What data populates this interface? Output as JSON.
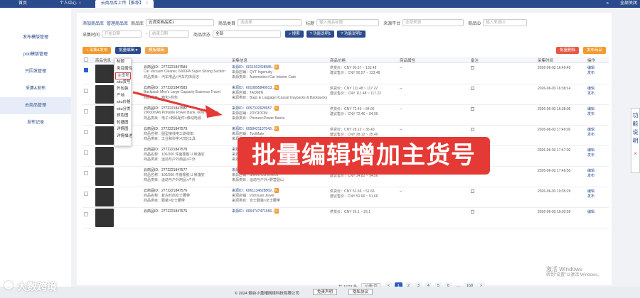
{
  "topbar": {
    "tabs": [
      {
        "label": "首页"
      },
      {
        "label": "个人中心"
      },
      {
        "label": "云商品库上传【推荐】"
      }
    ],
    "close_glyph": "×",
    "arrow_label": "»",
    "right_link": "全部关闭"
  },
  "sidebar": {
    "items": [
      {
        "label": "发布模版管理"
      },
      {
        "label": "pod模版管理"
      },
      {
        "label": "只因发管理"
      },
      {
        "label": "采集&发布"
      },
      {
        "label": "云商品管理"
      },
      {
        "label": "发布记录"
      }
    ]
  },
  "filters": {
    "link_add": "添加商品库",
    "link_manage": "管理商品库",
    "lib_label": "商品库",
    "lib_value": "云货奕商品库1",
    "cat_label": "商品类目",
    "cat_placeholder": "选选择",
    "title_label": "标题",
    "title_placeholder": "输入商品标题",
    "platform_label": "来源平台",
    "platform_placeholder": "全部来源",
    "pid_label": "商品ID",
    "pid_placeholder": "输入来源ID",
    "time_label": "采集时间",
    "start_placeholder": "开始日期",
    "to_label": "-",
    "end_placeholder": "结束日期",
    "status_label": "商品状态",
    "status_value": "全部",
    "search_btn": "搜索",
    "func1_btn": "功能说明1",
    "func2_btn": "功能说明2"
  },
  "actions": {
    "collect_publish": "采集&发布",
    "batch_edit": "批量编辑",
    "template_edit": "模板编辑",
    "batch_delete": "批量删除",
    "publish_goods": "发布商品"
  },
  "dropdown": {
    "items": [
      "标题",
      "类目属性",
      "主货号",
      "sku货号",
      "外包装",
      "产地",
      "sku价格",
      "sku分类",
      "颜色图",
      "轮播图",
      "详情图",
      "详情描述"
    ],
    "highlighted_index": 2
  },
  "table": {
    "headers": [
      "商品信息",
      "采集信息",
      "商品价格",
      "商品属性",
      "备注",
      "采集时间",
      "操作"
    ],
    "rows": [
      {
        "id": "云商品ID：2772221847584",
        "t1": "Car Vacuum Cleaner, 6000PA Super Strong Suction",
        "t2": "商品类目：汽车用品>汽车内饰清洁",
        "src_id": "来源ID：6011032328585...",
        "src_shop": "来源店铺：QYT Ingenuity",
        "src_cat": "来源类目：Automotive>Car Interior Care",
        "price1": "供货价：CNY 90.57 ~ 133.48",
        "price2": "建议售价：CNY 90.57 ~ 133.48",
        "attr": "--",
        "time": "2026-06-03 16:40:40",
        "op1": "编辑",
        "op2": "发布",
        "checked": true
      },
      {
        "id": "云商品ID：2772221847583",
        "t1": "Backpack Men's Large Capacity Business Travel",
        "t2": "商品类目：箱包>背包",
        "src_id": "来源ID：6010895840013...",
        "src_shop": "来源店铺：TAOMIN",
        "src_cat": "来源类目：Bags & Luggage>Casual Daypacks & Backpacks",
        "price1": "供货价：CNY 111.48 ~ 117.22",
        "price2": "建议售价：CNY 111.48 ~ 117.22",
        "attr": "--",
        "time": "2026-06-03 16:38:14",
        "op1": "编辑",
        "op2": "发布",
        "checked": false
      },
      {
        "id": "云商品ID：2772221847582",
        "t1": "20000mAh Portable Power Bank, 66W Portable",
        "t2": "商品类目：电子>数码配件>移动电源",
        "src_id": "来源ID：6057332628957...",
        "src_shop": "来源店铺：JOYROOM",
        "src_cat": "来源类目：Phones>Power Banks",
        "price1": "供货价：CNY 72.46 ~ 84.06",
        "price2": "建议售价：CNY 72.46 ~ 84.06",
        "attr": "--",
        "time": "2026-06-03 16:38:05",
        "op1": "编辑",
        "op2": "发布",
        "checked": false
      },
      {
        "id": "云商品ID：2772221847579",
        "t1": "商品名称：圆型接线电工剥线钳",
        "t2": "商品类目：工业和科学>切割工具",
        "src_id": "来源ID：6058421137543...",
        "src_shop": "来源店铺：ToolMate",
        "src_cat": "来源类目：工具>手动工具",
        "price1": "供货价：CNY 28.12 ~ 35.40",
        "price2": "建议售价：CNY 28.12 ~ 35.40",
        "attr": "--",
        "time": "2026-06-03 17:49:02",
        "op1": "编辑",
        "op2": "发布",
        "checked": false
      },
      {
        "id": "云商品ID：2772221847578",
        "t1": "商品名称：100/200 件装橡胶 U 帐篷钉",
        "t2": "商品类目：运动与户外用品>户外",
        "src_id": "来源ID：6056913972439...",
        "src_shop": "来源店铺：Shenri Commerce",
        "src_cat": "来源类目：运动与户外>野营登山",
        "price1": "供货价：CNY 34.62 ~ 94.56",
        "price2": "建议售价：CNY 34.62 ~ 94.56",
        "attr": "--",
        "time": "2026-06-03 17:47:02",
        "op1": "编辑",
        "op2": "发布",
        "checked": false
      },
      {
        "id": "云商品ID：2772221847577",
        "t1": "商品名称：100/200 件装橡胶 U 帐篷钉",
        "t2": "商品类目：运动与户外用品>户外",
        "src_id": "来源ID：6058913372439...",
        "src_shop": "来源店铺：Shenri Commerce",
        "src_cat": "来源类目：运动与户外>野营登山",
        "price1": "供货价：CNY 34.82 ~ 94.56",
        "price2": "建议售价：CNY 34.82 ~ 94.56",
        "attr": "--",
        "time": "2026-06-03 17:46:50",
        "op1": "编辑",
        "op2": "发布",
        "checked": false
      },
      {
        "id": "云商品ID：2772221847576",
        "t1": "商品名称：复古时尚女士腰带",
        "t2": "商品类目：服装>女士腰带",
        "src_id": "来源ID：6061134628869...",
        "src_shop": "来源店铺：Irishyuan Jewel",
        "src_cat": "来源类目：女士服装>女士腰带",
        "price1": "供货价：CNY 51.66 ~ 51.66",
        "price2": "建议售价：CNY 51.66 ~ 51.66",
        "attr": "--",
        "time": "2026-06-03 10:35:29",
        "op1": "编辑",
        "op2": "发布",
        "checked": false
      },
      {
        "id": "云商品ID：2772221847575",
        "t1": "",
        "t2": "",
        "src_id": "来源ID：6064747471566...",
        "src_shop": "",
        "src_cat": "",
        "price1": "供货价：CNY 26.1 ~ 26.1",
        "price2": "",
        "attr": "",
        "time": "2026-06-03 10:02:59",
        "op1": "编辑",
        "op2": "",
        "checked": false
      }
    ]
  },
  "banner": {
    "text": "批量编辑增加主货号"
  },
  "pagination": {
    "total": "共 1673 条",
    "per_page": "10条/页",
    "prev": "<",
    "pages": [
      "1",
      "2",
      "3",
      "4",
      "5",
      "6"
    ],
    "ellipsis": "...",
    "last": "168",
    "next": ">",
    "current": "1"
  },
  "footer": {
    "copyright": "© 2024 烟台小盖帽网络科技有限公司",
    "btn1": "免责声明",
    "btn2": "隐私协议"
  },
  "help": {
    "chars": [
      "功",
      "能",
      "说",
      "明"
    ],
    "close": "×"
  },
  "watermark": {
    "text": "大数跨境"
  },
  "activate": {
    "line1": "激活 Windows",
    "line2": "转到\"设置\"以激活 Windows。"
  },
  "colors": {
    "primary": "#2b4c8c",
    "accent": "#f39a2b",
    "danger": "#e53935"
  }
}
